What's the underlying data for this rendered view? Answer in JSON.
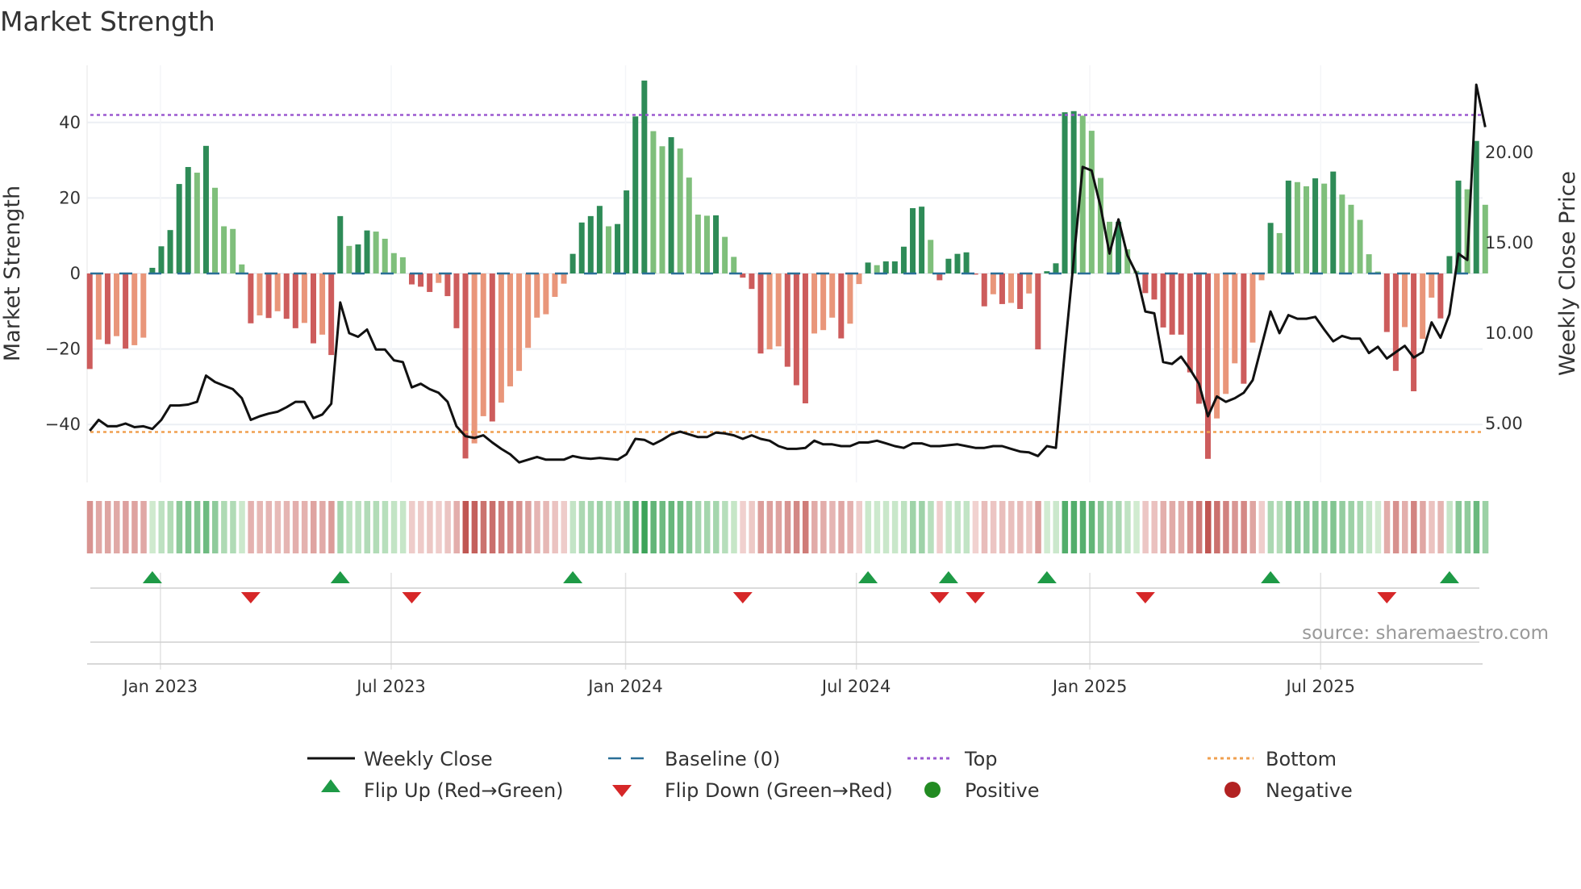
{
  "title": "Market Strength",
  "source": "source: sharemaestro.com",
  "colors": {
    "pos_strong": "#2e8b57",
    "pos_weak": "#7fbf7b",
    "neg_strong": "#cd5c5c",
    "neg_weak": "#e9967a",
    "close": "#111111",
    "baseline": "#2a6f97",
    "top": "#9b59d0",
    "bottom": "#f0a050",
    "flip_up": "#1e9a46",
    "flip_down": "#d62728",
    "positive": "#228b22",
    "negative": "#b22222"
  },
  "legend": {
    "close": "Weekly Close",
    "baseline": "Baseline (0)",
    "top": "Top",
    "bottom": "Bottom",
    "flip_up": "Flip Up (Red→Green)",
    "flip_down": "Flip Down (Green→Red)",
    "positive": "Positive",
    "negative": "Negative"
  },
  "chart_data": {
    "type": "bar",
    "title": "Market Strength",
    "ylabel": "Market Strength",
    "y2label": "Weekly Close Price",
    "ylim": [
      -55,
      55
    ],
    "y2lim": [
      1.74,
      24.8
    ],
    "top_level": 42,
    "bottom_level": -42,
    "baseline": 0,
    "x_unit": "week index",
    "yticks_left": [
      {
        "value": 40,
        "label": "40"
      },
      {
        "value": 20,
        "label": "20"
      },
      {
        "value": 0,
        "label": "0"
      },
      {
        "value": -20,
        "label": "−20"
      },
      {
        "value": -40,
        "label": "−40"
      }
    ],
    "yticks_right": [
      {
        "value": 20,
        "label": "20.00"
      },
      {
        "value": 15,
        "label": "15.00"
      },
      {
        "value": 10,
        "label": "10.00"
      },
      {
        "value": 5,
        "label": "5.00"
      }
    ],
    "xticks": [
      {
        "week": 7.9,
        "label": "Jan 2023"
      },
      {
        "week": 33.7,
        "label": "Jul 2023"
      },
      {
        "week": 59.9,
        "label": "Jan 2024"
      },
      {
        "week": 85.7,
        "label": "Jul 2024"
      },
      {
        "week": 111.8,
        "label": "Jan 2025"
      },
      {
        "week": 137.6,
        "label": "Jul 2025"
      }
    ],
    "strength": [
      -25.3,
      -17.5,
      -18.7,
      -16.6,
      -19.9,
      -19,
      -17,
      1.5,
      7.2,
      11.5,
      23.7,
      28.2,
      26.7,
      33.8,
      22.7,
      12.5,
      11.8,
      2.4,
      -13.2,
      -11.1,
      -11.8,
      -10,
      -12,
      -14.5,
      -13.1,
      -18.5,
      -16.2,
      -21.6,
      15.2,
      7.3,
      7.7,
      11.4,
      11.1,
      9.2,
      5.4,
      4.3,
      -2.9,
      -3.5,
      -4.9,
      -2.5,
      -6,
      -14.5,
      -49,
      -45,
      -37.8,
      -39.2,
      -34.2,
      -29.9,
      -25.8,
      -19.7,
      -11.7,
      -10.8,
      -6.2,
      -2.7,
      5.2,
      13.5,
      15.2,
      17.9,
      12.5,
      13.1,
      22,
      41.6,
      51.1,
      37.7,
      33.7,
      36.1,
      33.1,
      25.4,
      15.6,
      15.3,
      15.4,
      9.7,
      4.4,
      -1.1,
      -4.1,
      -21.2,
      -20.1,
      -19.3,
      -24.7,
      -29.6,
      -34.4,
      -15.9,
      -15,
      -11.7,
      -17.2,
      -13.3,
      -2.8,
      2.9,
      2.2,
      3.2,
      3.2,
      7.1,
      17.3,
      17.7,
      8.9,
      -1.8,
      3.9,
      5.2,
      5.6,
      -0.3,
      -8.7,
      -5.5,
      -8.1,
      -7.8,
      -9.4,
      -5.3,
      -20.1,
      0.6,
      2.7,
      42.7,
      43,
      41.8,
      37.8,
      25.3,
      13.7,
      13.7,
      6.4,
      0.7,
      -5.2,
      -6.9,
      -14.3,
      -16.2,
      -16.2,
      -26.2,
      -34.5,
      -49.1,
      -38.4,
      -31.9,
      -23.8,
      -29.2,
      -18.3,
      -1.8,
      13.4,
      10.7,
      24.6,
      24.2,
      23.1,
      25.2,
      23.8,
      27,
      20.9,
      18.2,
      14.2,
      5.1,
      0.5,
      -15.5,
      -25.8,
      -14.2,
      -31.2,
      -17.3,
      -6.4,
      -11.9,
      4.6,
      24.6,
      22.3,
      35.1,
      18.2
    ],
    "weekly_close": [
      4.6,
      5.2,
      4.85,
      4.85,
      5.0,
      4.8,
      4.85,
      4.7,
      5.2,
      6.0,
      6.0,
      6.05,
      6.2,
      7.65,
      7.3,
      7.1,
      6.9,
      6.4,
      5.2,
      5.4,
      5.55,
      5.65,
      5.9,
      6.2,
      6.2,
      5.3,
      5.5,
      6.1,
      11.7,
      10.0,
      9.8,
      10.2,
      9.1,
      9.1,
      8.5,
      8.4,
      7.0,
      7.2,
      6.9,
      6.7,
      6.2,
      4.85,
      4.3,
      4.2,
      4.35,
      3.95,
      3.6,
      3.3,
      2.85,
      3.0,
      3.15,
      3.0,
      3.0,
      3.0,
      3.2,
      3.1,
      3.05,
      3.1,
      3.05,
      3.0,
      3.3,
      4.15,
      4.1,
      3.85,
      4.1,
      4.4,
      4.55,
      4.4,
      4.25,
      4.25,
      4.5,
      4.45,
      4.35,
      4.15,
      4.35,
      4.15,
      4.05,
      3.75,
      3.6,
      3.6,
      3.65,
      4.05,
      3.85,
      3.85,
      3.75,
      3.75,
      3.95,
      3.95,
      4.05,
      3.9,
      3.75,
      3.65,
      3.9,
      3.9,
      3.75,
      3.75,
      3.8,
      3.85,
      3.75,
      3.65,
      3.65,
      3.75,
      3.75,
      3.6,
      3.45,
      3.4,
      3.2,
      3.75,
      3.65,
      9.0,
      14.1,
      19.2,
      19.0,
      17.0,
      14.4,
      16.3,
      14.3,
      13.3,
      11.2,
      11.1,
      8.4,
      8.3,
      8.7,
      8.0,
      7.2,
      5.4,
      6.5,
      6.2,
      6.4,
      6.7,
      7.4,
      9.3,
      11.2,
      10.0,
      11.0,
      10.8,
      10.8,
      10.9,
      10.2,
      9.55,
      9.85,
      9.7,
      9.7,
      8.9,
      9.25,
      8.6,
      8.95,
      9.3,
      8.65,
      8.95,
      10.6,
      9.75,
      11.05,
      14.4,
      14.05,
      23.75,
      21.4
    ],
    "flip_up_weeks": [
      7,
      28,
      54,
      87,
      96,
      107,
      132,
      152
    ],
    "flip_down_weeks": [
      18,
      36,
      73,
      95,
      99,
      118,
      145
    ]
  }
}
